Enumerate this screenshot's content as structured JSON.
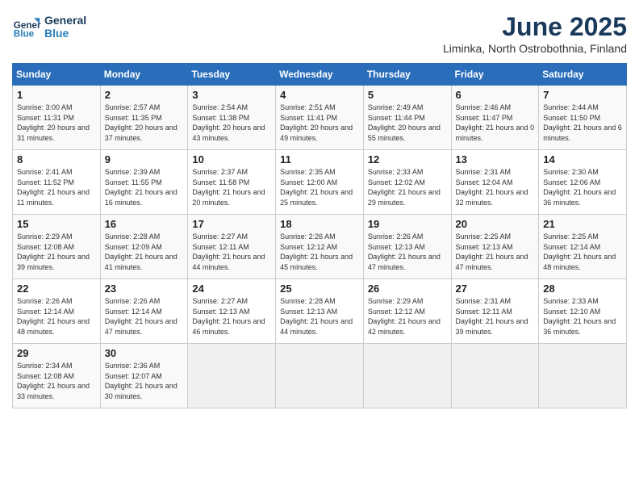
{
  "logo": {
    "line1": "General",
    "line2": "Blue"
  },
  "title": "June 2025",
  "subtitle": "Liminka, North Ostrobothnia, Finland",
  "weekdays": [
    "Sunday",
    "Monday",
    "Tuesday",
    "Wednesday",
    "Thursday",
    "Friday",
    "Saturday"
  ],
  "weeks": [
    [
      {
        "day": "1",
        "sunrise": "3:00 AM",
        "sunset": "11:31 PM",
        "daylight": "20 hours and 31 minutes."
      },
      {
        "day": "2",
        "sunrise": "2:57 AM",
        "sunset": "11:35 PM",
        "daylight": "20 hours and 37 minutes."
      },
      {
        "day": "3",
        "sunrise": "2:54 AM",
        "sunset": "11:38 PM",
        "daylight": "20 hours and 43 minutes."
      },
      {
        "day": "4",
        "sunrise": "2:51 AM",
        "sunset": "11:41 PM",
        "daylight": "20 hours and 49 minutes."
      },
      {
        "day": "5",
        "sunrise": "2:49 AM",
        "sunset": "11:44 PM",
        "daylight": "20 hours and 55 minutes."
      },
      {
        "day": "6",
        "sunrise": "2:46 AM",
        "sunset": "11:47 PM",
        "daylight": "21 hours and 0 minutes."
      },
      {
        "day": "7",
        "sunrise": "2:44 AM",
        "sunset": "11:50 PM",
        "daylight": "21 hours and 6 minutes."
      }
    ],
    [
      {
        "day": "8",
        "sunrise": "2:41 AM",
        "sunset": "11:52 PM",
        "daylight": "21 hours and 11 minutes."
      },
      {
        "day": "9",
        "sunrise": "2:39 AM",
        "sunset": "11:55 PM",
        "daylight": "21 hours and 16 minutes."
      },
      {
        "day": "10",
        "sunrise": "2:37 AM",
        "sunset": "11:58 PM",
        "daylight": "21 hours and 20 minutes."
      },
      {
        "day": "11",
        "sunrise": "2:35 AM",
        "sunset": "12:00 AM",
        "daylight": "21 hours and 25 minutes."
      },
      {
        "day": "12",
        "sunrise": "2:33 AM",
        "sunset": "12:02 AM",
        "daylight": "21 hours and 29 minutes."
      },
      {
        "day": "13",
        "sunrise": "2:31 AM",
        "sunset": "12:04 AM",
        "daylight": "21 hours and 32 minutes."
      },
      {
        "day": "14",
        "sunrise": "2:30 AM",
        "sunset": "12:06 AM",
        "daylight": "21 hours and 36 minutes."
      }
    ],
    [
      {
        "day": "15",
        "sunrise": "2:29 AM",
        "sunset": "12:08 AM",
        "daylight": "21 hours and 39 minutes."
      },
      {
        "day": "16",
        "sunrise": "2:28 AM",
        "sunset": "12:09 AM",
        "daylight": "21 hours and 41 minutes."
      },
      {
        "day": "17",
        "sunrise": "2:27 AM",
        "sunset": "12:11 AM",
        "daylight": "21 hours and 44 minutes."
      },
      {
        "day": "18",
        "sunrise": "2:26 AM",
        "sunset": "12:12 AM",
        "daylight": "21 hours and 45 minutes."
      },
      {
        "day": "19",
        "sunrise": "2:26 AM",
        "sunset": "12:13 AM",
        "daylight": "21 hours and 47 minutes."
      },
      {
        "day": "20",
        "sunrise": "2:25 AM",
        "sunset": "12:13 AM",
        "daylight": "21 hours and 47 minutes."
      },
      {
        "day": "21",
        "sunrise": "2:25 AM",
        "sunset": "12:14 AM",
        "daylight": "21 hours and 48 minutes."
      }
    ],
    [
      {
        "day": "22",
        "sunrise": "2:26 AM",
        "sunset": "12:14 AM",
        "daylight": "21 hours and 48 minutes."
      },
      {
        "day": "23",
        "sunrise": "2:26 AM",
        "sunset": "12:14 AM",
        "daylight": "21 hours and 47 minutes."
      },
      {
        "day": "24",
        "sunrise": "2:27 AM",
        "sunset": "12:13 AM",
        "daylight": "21 hours and 46 minutes."
      },
      {
        "day": "25",
        "sunrise": "2:28 AM",
        "sunset": "12:13 AM",
        "daylight": "21 hours and 44 minutes."
      },
      {
        "day": "26",
        "sunrise": "2:29 AM",
        "sunset": "12:12 AM",
        "daylight": "21 hours and 42 minutes."
      },
      {
        "day": "27",
        "sunrise": "2:31 AM",
        "sunset": "12:11 AM",
        "daylight": "21 hours and 39 minutes."
      },
      {
        "day": "28",
        "sunrise": "2:33 AM",
        "sunset": "12:10 AM",
        "daylight": "21 hours and 36 minutes."
      }
    ],
    [
      {
        "day": "29",
        "sunrise": "2:34 AM",
        "sunset": "12:08 AM",
        "daylight": "21 hours and 33 minutes."
      },
      {
        "day": "30",
        "sunrise": "2:36 AM",
        "sunset": "12:07 AM",
        "daylight": "21 hours and 30 minutes."
      },
      null,
      null,
      null,
      null,
      null
    ]
  ]
}
